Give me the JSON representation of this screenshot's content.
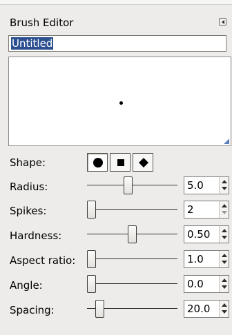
{
  "dock": {
    "title": "Brush Editor",
    "menu_icon": "tab-menu-icon"
  },
  "brush_name": "Untitled",
  "shape": {
    "label": "Shape:",
    "options": [
      {
        "name": "circle",
        "icon": "circle-icon",
        "active": true
      },
      {
        "name": "square",
        "icon": "square-icon",
        "active": false
      },
      {
        "name": "diamond",
        "icon": "diamond-icon",
        "active": false
      }
    ]
  },
  "params": [
    {
      "label": "Radius:",
      "value": "5.0",
      "fraction": 0.45
    },
    {
      "label": "Spikes:",
      "value": "2",
      "fraction": 0.0
    },
    {
      "label": "Hardness:",
      "value": "0.50",
      "fraction": 0.5
    },
    {
      "label": "Aspect ratio:",
      "value": "1.0",
      "fraction": 0.0
    },
    {
      "label": "Angle:",
      "value": "0.0",
      "fraction": 0.0
    },
    {
      "label": "Spacing:",
      "value": "20.0",
      "fraction": 0.1
    }
  ]
}
